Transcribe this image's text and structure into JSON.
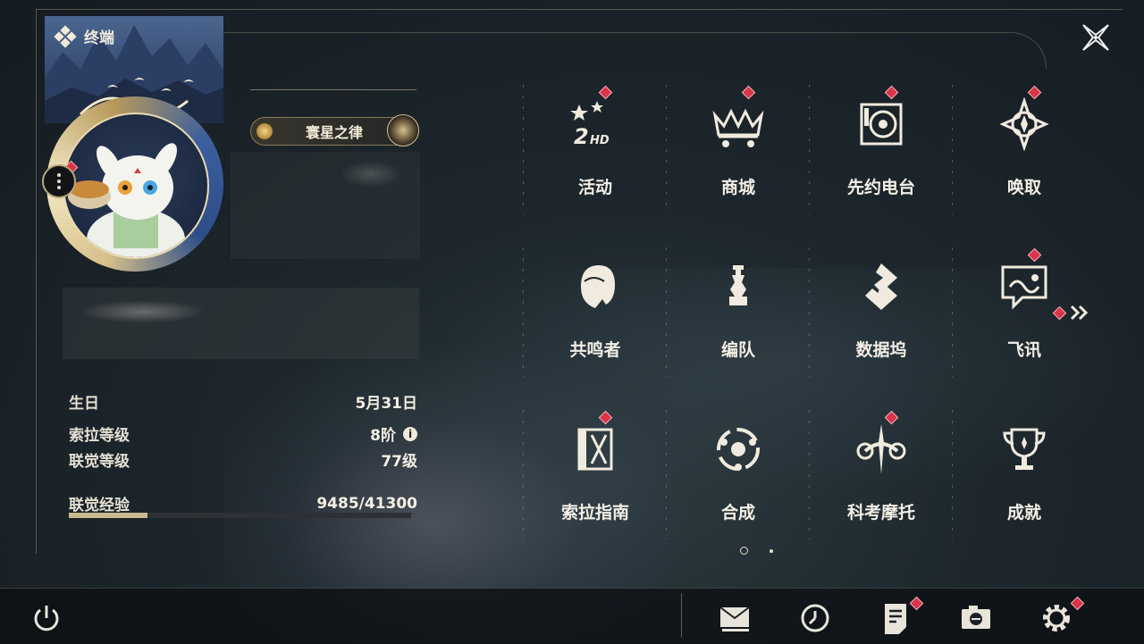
{
  "terminal": {
    "title": "终端"
  },
  "profile": {
    "title_badge": "寰星之律",
    "birthday_label": "生日",
    "birthday_value": "5月31日",
    "sola_level_label": "索拉等级",
    "sola_level_value": "8阶",
    "union_level_label": "联觉等级",
    "union_level_value": "77级",
    "union_exp_label": "联觉经验",
    "union_exp_value": "9485/41300",
    "union_exp_progress": 0.2297
  },
  "menu": {
    "items": [
      {
        "label": "活动",
        "icon": "events-2hd-icon",
        "badge": true
      },
      {
        "label": "商城",
        "icon": "shop-crown-cart-icon",
        "badge": true
      },
      {
        "label": "先约电台",
        "icon": "pioneer-radio-icon",
        "badge": true
      },
      {
        "label": "唤取",
        "icon": "convene-compass-icon",
        "badge": true
      },
      {
        "label": "共鸣者",
        "icon": "resonator-portrait-icon",
        "badge": false
      },
      {
        "label": "编队",
        "icon": "team-chess-icon",
        "badge": false
      },
      {
        "label": "数据坞",
        "icon": "data-bank-icon",
        "badge": false
      },
      {
        "label": "飞讯",
        "icon": "message-chat-icon",
        "badge": true
      },
      {
        "label": "索拉指南",
        "icon": "sola-guide-icon",
        "badge": true
      },
      {
        "label": "合成",
        "icon": "synthesis-icon",
        "badge": false
      },
      {
        "label": "科考摩托",
        "icon": "research-motorbike-icon",
        "badge": true
      },
      {
        "label": "成就",
        "icon": "achievement-trophy-icon",
        "badge": false
      }
    ],
    "page_count": 2,
    "current_page": 1
  },
  "colors": {
    "accent_gold": "#c9ba8e",
    "badge_red": "#d8344a",
    "text": "#f3efe5"
  }
}
